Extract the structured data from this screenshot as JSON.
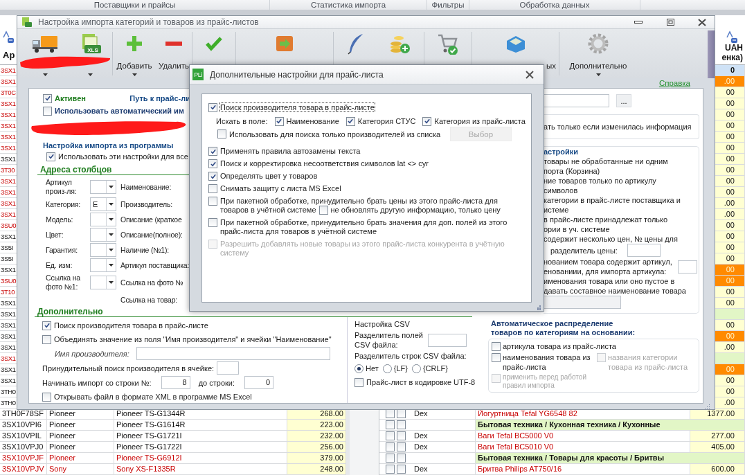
{
  "ribbon_groups": [
    "Поставщики и прайсы",
    "Статистика импорта",
    "Фильтры",
    "Обработка данных"
  ],
  "left_grid": {
    "header": "Ар",
    "rows": [
      {
        "code": "3SX1",
        "flagged": true
      },
      {
        "code": "3SX1",
        "flagged": true
      },
      {
        "code": "3T0C",
        "flagged": true
      },
      {
        "code": "3SX1",
        "flagged": true
      },
      {
        "code": "3SX1",
        "flagged": true
      },
      {
        "code": "3SX1",
        "flagged": true
      },
      {
        "code": "3SX1",
        "flagged": true
      },
      {
        "code": "3SX1",
        "flagged": true
      },
      {
        "code": "3SX1",
        "flagged": false
      },
      {
        "code": "3T30",
        "flagged": true
      },
      {
        "code": "3SX1",
        "flagged": true
      },
      {
        "code": "3SX1",
        "flagged": true
      },
      {
        "code": "3SX1",
        "flagged": true
      },
      {
        "code": "3SX1",
        "flagged": true
      },
      {
        "code": "3SU0",
        "flagged": true
      },
      {
        "code": "3SX1",
        "flagged": false
      },
      {
        "code": "3S5I",
        "flagged": false
      },
      {
        "code": "3S5I",
        "flagged": false
      },
      {
        "code": "3SX1",
        "flagged": false
      },
      {
        "code": "3SU0",
        "flagged": true
      },
      {
        "code": "3T10",
        "flagged": true
      },
      {
        "code": "3SX1",
        "flagged": false
      },
      {
        "code": "3SX1",
        "flagged": false
      },
      {
        "code": "3SX1",
        "flagged": false
      },
      {
        "code": "3SX1",
        "flagged": false
      },
      {
        "code": "3SX1",
        "flagged": false
      },
      {
        "code": "3SX1",
        "flagged": true
      },
      {
        "code": "3SX1",
        "flagged": false
      },
      {
        "code": "3SX1",
        "flagged": false
      },
      {
        "code": "3TH0",
        "flagged": false
      },
      {
        "code": "3TH0",
        "flagged": false
      },
      {
        "code": "3TH0F78SF",
        "brand": "Pioneer",
        "model": "Pioneer TS-G1344R",
        "price": "268.00",
        "flagged": false
      },
      {
        "code": "3SX10VPI6",
        "brand": "Pioneer",
        "model": "Pioneer TS-G1614R",
        "price": "223.00",
        "flagged": false
      },
      {
        "code": "3SX10VPIL",
        "brand": "Pioneer",
        "model": "Pioneer TS-G1721I",
        "price": "232.00",
        "flagged": false
      },
      {
        "code": "3SX10VPJ0",
        "brand": "Pioneer",
        "model": "Pioneer TS-G1722I",
        "price": "256.00",
        "flagged": false
      },
      {
        "code": "3SX10VPJF",
        "brand": "Pioneer",
        "model": "Pioneer TS-G6912I",
        "price": "379.00",
        "flagged": true
      },
      {
        "code": "3SX10VPJV",
        "brand": "Sony",
        "model": "Sony XS-F1335R",
        "price": "248.00",
        "flagged": true
      }
    ]
  },
  "right_grid": {
    "header": [
      "UAH",
      "енка)"
    ],
    "rows": [
      {
        "kind": "price",
        "price": "0",
        "highlighted": false,
        "selected": true
      },
      {
        "kind": "price",
        "price": ".00",
        "highlighted": true,
        "selected": false
      },
      {
        "kind": "price",
        "price": "00",
        "highlighted": false,
        "selected": false
      },
      {
        "kind": "price",
        "price": "00",
        "highlighted": false,
        "selected": false
      },
      {
        "kind": "price",
        "price": "00",
        "highlighted": false,
        "selected": false
      },
      {
        "kind": "price",
        "price": "00",
        "highlighted": false,
        "selected": false
      },
      {
        "kind": "price",
        "price": "00",
        "highlighted": false,
        "selected": false
      },
      {
        "kind": "price",
        "price": "00",
        "highlighted": false,
        "selected": false
      },
      {
        "kind": "price",
        "price": "00",
        "highlighted": false,
        "selected": false
      },
      {
        "kind": "price",
        "price": "00",
        "highlighted": false,
        "selected": false
      },
      {
        "kind": "price",
        "price": "00",
        "highlighted": false,
        "selected": false
      },
      {
        "kind": "price",
        "price": "00",
        "highlighted": false,
        "selected": false
      },
      {
        "kind": "price",
        "price": ".00",
        "highlighted": false,
        "selected": false
      },
      {
        "kind": "price",
        "price": ".00",
        "highlighted": false,
        "selected": false
      },
      {
        "kind": "price",
        "price": "00",
        "highlighted": false,
        "selected": false
      },
      {
        "kind": "price",
        "price": "00",
        "highlighted": false,
        "selected": false
      },
      {
        "kind": "price",
        "price": "00",
        "highlighted": false,
        "selected": false
      },
      {
        "kind": "price",
        "price": "00",
        "highlighted": false,
        "selected": false
      },
      {
        "kind": "price",
        "price": "00",
        "highlighted": true,
        "selected": false
      },
      {
        "kind": "price",
        "price": "00",
        "highlighted": true,
        "selected": false
      },
      {
        "kind": "price",
        "price": "00",
        "highlighted": false,
        "selected": false
      },
      {
        "kind": "price",
        "price": "00",
        "highlighted": false,
        "selected": false
      },
      {
        "kind": "category",
        "selected": false
      },
      {
        "kind": "price",
        "price": "00",
        "highlighted": false,
        "selected": false
      },
      {
        "kind": "price",
        "price": "00",
        "highlighted": true,
        "selected": false
      },
      {
        "kind": "price",
        "price": ".00",
        "highlighted": false,
        "selected": false
      },
      {
        "kind": "category",
        "selected": false
      },
      {
        "kind": "price",
        "price": "00",
        "highlighted": true,
        "selected": false
      },
      {
        "kind": "price",
        "price": "00",
        "highlighted": false,
        "selected": false
      },
      {
        "kind": "price",
        "price": "00",
        "highlighted": false,
        "selected": false
      },
      {
        "kind": "price",
        "price": ".00",
        "highlighted": false,
        "selected": false
      },
      {
        "kind": "product",
        "checkboxes": [
          {
            "checked": false
          },
          {
            "checked": false
          }
        ],
        "brand": "Dex",
        "name": "Йогуртница Tefal YG6548 82",
        "price": "1377.00",
        "flagged": true,
        "highlighted": false,
        "selected": false
      },
      {
        "kind": "category",
        "checkboxes": [
          {
            "checked": false
          },
          {
            "checked": false
          }
        ],
        "name": "Бытовая техника / Кухонная техника / Кухонные",
        "selected": false
      },
      {
        "kind": "product",
        "checkboxes": [
          {
            "checked": false
          },
          {
            "checked": false
          }
        ],
        "brand": "Dex",
        "name": "Ваги Tefal BC5000 V0",
        "price": "277.00",
        "flagged": true,
        "highlighted": false,
        "selected": false
      },
      {
        "kind": "product",
        "checkboxes": [
          {
            "checked": false
          },
          {
            "checked": false
          }
        ],
        "brand": "Dex",
        "name": "Ваги Tefal BC5010 V0",
        "price": "405.00",
        "flagged": true,
        "highlighted": false,
        "selected": false
      },
      {
        "kind": "category",
        "checkboxes": [
          {
            "checked": false
          },
          {
            "checked": false
          }
        ],
        "name": "Бытовая техника / Товары для красоты / Бритвы",
        "selected": false
      },
      {
        "kind": "product",
        "checkboxes": [
          {
            "checked": false
          },
          {
            "checked": false
          }
        ],
        "brand": "Dex",
        "name": "Бритва Philips AT750/16",
        "price": "600.00",
        "flagged": true,
        "highlighted": false,
        "selected": false
      }
    ]
  },
  "main_window": {
    "title": "Настройка импорта категорий и товаров из прайс-листов",
    "toolbar": [
      {
        "dropdown": true
      },
      {
        "dropdown": true,
        "badge": "XLS"
      },
      {
        "label": "Добавить",
        "dropdown": true
      },
      {
        "label": "Удалить",
        "dropdown": false
      },
      {
        "dropdown": false
      },
      {
        "dropdown": false
      },
      {
        "dropdown": false
      },
      {
        "dropdown": false
      },
      {
        "dropdown": false
      },
      {
        "label": "ых",
        "dropdown": false
      },
      {
        "label": "Дополнительно",
        "dropdown": true
      }
    ],
    "help_link": "Справка",
    "active": {
      "label": "Активен",
      "checked": true
    },
    "path_label": "Путь к прайс-ли",
    "auto_import": {
      "label": "Использовать автоматический им",
      "checked": false
    },
    "import_group": {
      "title": "Настройка импорта из программы",
      "use_for_all": {
        "label": "Использовать эти настройки для все",
        "checked": true
      }
    },
    "columns_title": "Адреса столбцов",
    "column_rows": [
      {
        "label": "Артикул произ-ля:",
        "value": "",
        "right_label": "Наименование:"
      },
      {
        "label": "Категория:",
        "value": "E",
        "right_label": "Производитель:"
      },
      {
        "label": "Модель:",
        "value": "",
        "right_label": "Описание (краткое"
      },
      {
        "label": "Цвет:",
        "value": "",
        "right_label": "Описание(полное):"
      },
      {
        "label": "Гарантия:",
        "value": "",
        "right_label": "Наличие (№1):"
      },
      {
        "label": "Ед. изм:",
        "value": "",
        "right_label": "Артикул поставщика:"
      },
      {
        "label": "Ссылка на фото №1:",
        "value": "",
        "right_label": "Ссылка на фото №"
      },
      {
        "right_label": "Ссылка на товар:"
      }
    ],
    "extra": {
      "title": "Дополнительно",
      "find_manufacturer": {
        "label": "Поиск производителя товара в прайс-листе",
        "checked": true
      },
      "merge": {
        "label": "Объединять значение из поля \"Имя производителя\" и ячейки \"Наименование\"",
        "checked": false
      },
      "manufacturer_name_label": "Имя производителя:",
      "forced_search_label": "Принудительный поиск производителя в ячейке:",
      "start_row_label": "Начинать импорт со строки №:",
      "start_row": "8",
      "end_row_label": "до строки:",
      "end_row": "0",
      "open_xml": {
        "label": "Открывать файл в формате XML в программе MS Excel",
        "checked": false
      }
    },
    "csv": {
      "title": "Настройка CSV",
      "field_separator_label": "Разделитель полей CSV файла:",
      "row_separator_label": "Разделитель строк CSV файла:",
      "row_separators": [
        {
          "label": "Нет",
          "selected": true
        },
        {
          "label": "{LF}",
          "selected": false
        },
        {
          "label": "{CRLF}",
          "selected": false
        }
      ],
      "utf8": {
        "label": "Прайс-лист в кодировке UTF-8",
        "checked": false
      }
    },
    "browse_button": "...",
    "update_note": "ать только если изменилась информация",
    "settings": {
      "title": "астройки",
      "lines": [
        "товары не обработанные ни одним",
        "порта (Корзина)",
        "ние товаров только по артикулу",
        "символов",
        "категории в прайс-листе поставщика и",
        "истеме",
        "в прайс-листе принадлежат только",
        "ории в уч. системе",
        "содержит несколько цен, № цены для"
      ],
      "price_separator_label": "разделитель цены:",
      "article_lines": [
        "нованием товара содержит артикул,",
        "енованиии, для импорта артикула:"
      ],
      "name_lines": [
        "именования товара или оно пустое в",
        "давать составное наименование товара"
      ]
    },
    "auto_distribution": {
      "title": "Автоматическое распределение товаров по категориям на основании:",
      "options": [
        {
          "label": "артикула товара из прайс-листа",
          "checked": false,
          "disabled": false
        },
        {
          "label": "наименования товара из прайс-листа",
          "checked": false,
          "disabled": false
        },
        {
          "label": "названия  категории товара из прайс-листа",
          "checked": false,
          "disabled": true
        },
        {
          "label": "применить перед работой правил импорта",
          "checked": false,
          "disabled": true
        }
      ]
    }
  },
  "dialog": {
    "icon_text": "PLi",
    "title": "Дополнительные настройки для прайс-листа",
    "find_manufacturer": {
      "label": "Поиск производителя товара в прайс-листе",
      "checked": true,
      "focused": true
    },
    "search_in": {
      "label": "Искать в поле:",
      "fields": [
        {
          "label": "Наименование",
          "checked": true
        },
        {
          "label": "Категория СТУС",
          "checked": true
        },
        {
          "label": "Категория из прайс-листа",
          "checked": true
        }
      ]
    },
    "only_listed": {
      "label": "Использовать для поиска только производителей из списка",
      "checked": false
    },
    "choose_button": {
      "label": "Выбор",
      "disabled": true
    },
    "options": [
      {
        "label": "Применять правила автозамены текста",
        "checked": true,
        "disabled": false
      },
      {
        "label": "Поиск и корректировка несоответствия символов lat <> cyr",
        "checked": true,
        "disabled": false
      },
      {
        "label": "Определять цвет у товаров",
        "checked": true,
        "disabled": false
      },
      {
        "label": "Снимать защиту с листа MS Excel",
        "checked": false,
        "disabled": false
      },
      {
        "lines": [
          "При пакетной обработке, принудительно брать цены из этого прайс-листа для",
          "товаров в учётной системе"
        ],
        "checked": false,
        "disabled": false,
        "inline": {
          "label": "не обновлять другую информацию, только цену",
          "checked": false
        }
      },
      {
        "label": "При пакетной обработке, принудительно брать значения для доп. полей из этого прайс-листа для товаров в учётной системе",
        "checked": false,
        "disabled": false
      },
      {
        "label": "Разрешить добавлять новые товары из этого прайс-листа конкурента в учётную систему",
        "checked": false,
        "disabled": true
      }
    ]
  }
}
